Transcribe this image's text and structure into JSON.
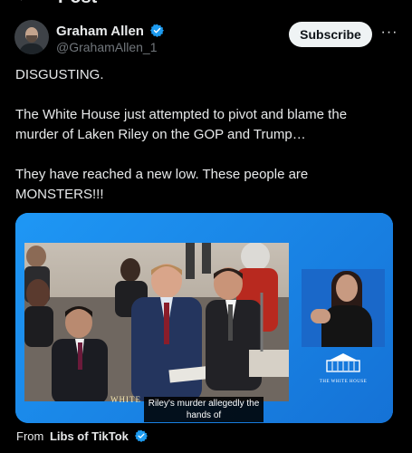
{
  "header": {
    "back_icon": "back-arrow-icon",
    "title": "Post"
  },
  "author": {
    "display_name": "Graham Allen",
    "handle": "@GrahamAllen_1",
    "verified_icon": "verified-badge-icon",
    "subscribe_label": "Subscribe",
    "more_label": "···"
  },
  "post": {
    "lines": [
      "DISGUSTING.",
      "The White House just attempted to pivot and blame the murder of Laken Riley on the GOP and Trump…",
      "They have reached a new low. These people are MONSTERS!!!"
    ]
  },
  "media": {
    "lower_third": "WHITE",
    "caption": "Riley's murder allegedly the hands of",
    "logo_text": "THE WHITE HOUSE"
  },
  "source": {
    "label": "From",
    "name": "Libs of TikTok"
  },
  "colors": {
    "background": "#000000",
    "text": "#e7e9ea",
    "muted": "#71767b",
    "verified": "#1d9bf0",
    "media_blue": "#1b8ff0"
  }
}
